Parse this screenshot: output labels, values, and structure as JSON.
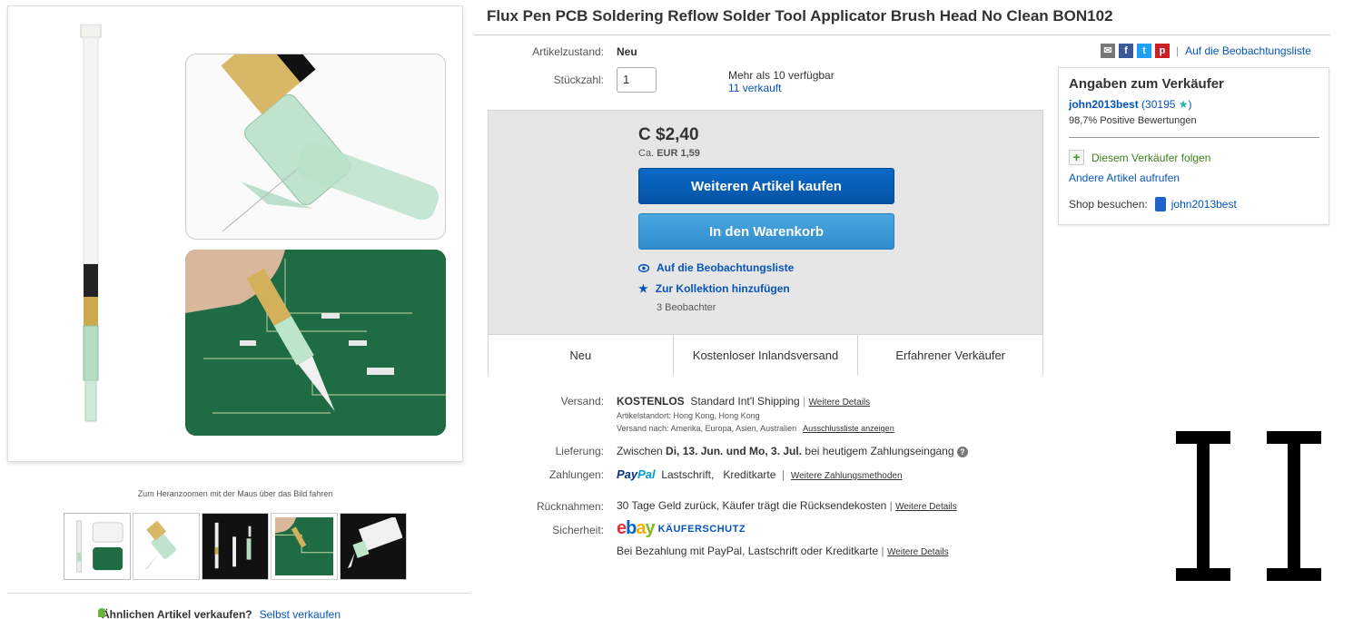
{
  "listing": {
    "title": "Flux Pen PCB Soldering Reflow Solder Tool Applicator Brush Head No Clean BON102"
  },
  "gallery": {
    "zoom_hint": "Zum Heranzoomen mit der Maus über das Bild fahren",
    "thumbnail_count": 5
  },
  "condition": {
    "label": "Artikelzustand:",
    "value": "Neu"
  },
  "quantity": {
    "label": "Stückzahl:",
    "value": "1",
    "available": "Mehr als 10 verfügbar",
    "sold": "11 verkauft"
  },
  "buy_box": {
    "price": "C $2,40",
    "approx_prefix": "Ca.",
    "approx_value": "EUR 1,59",
    "buy_button": "Weiteren Artikel kaufen",
    "cart_button": "In den Warenkorb",
    "watch_link": "Auf die Beobachtungsliste",
    "collection_link": "Zur Kollektion hinzufügen",
    "watchers": "3 Beobachter",
    "tiles": [
      "Neu",
      "Kostenloser Inlandsversand",
      "Erfahrener Verkäufer"
    ]
  },
  "shipping": {
    "label": "Versand:",
    "free": "KOSTENLOS",
    "method": "Standard Int'l Shipping",
    "details": "Weitere Details",
    "location": "Artikelstandort:  Hong Kong, Hong Kong",
    "ships_to": "Versand nach:  Amerika, Europa, Asien, Australien",
    "exclusions": "Ausschlussliste anzeigen"
  },
  "delivery": {
    "label": "Lieferung:",
    "prefix": "Zwischen",
    "range": "Di, 13. Jun. und Mo, 3. Jul.",
    "suffix": "bei heutigem Zahlungseingang"
  },
  "payments": {
    "label": "Zahlungen:",
    "paypal_a": "Pay",
    "paypal_b": "Pal",
    "methods": "Lastschrift,   Kreditkarte",
    "more": "Weitere Zahlungsmethoden"
  },
  "returns": {
    "label": "Rücknahmen:",
    "text": "30 Tage Geld zurück, Käufer trägt die Rücksendekosten",
    "details": "Weitere Details"
  },
  "security": {
    "label": "Sicherheit:",
    "brand_e": "e",
    "brand_b": "b",
    "brand_a": "a",
    "brand_y": "y",
    "badge": "KÄUFERSCHUTZ",
    "text": "Bei Bezahlung mit PayPal, Lastschrift oder Kreditkarte",
    "details": "Weitere Details"
  },
  "share": {
    "watchlist_link": "Auf die Beobachtungsliste",
    "icons": [
      "email-icon",
      "facebook-icon",
      "twitter-icon",
      "pinterest-icon"
    ]
  },
  "seller": {
    "heading": "Angaben zum Verkäufer",
    "name": "john2013best",
    "score_open": "(30195",
    "score_close": ")",
    "positive": "98,7% Positive Bewertungen",
    "follow": "Diesem Verkäufer folgen",
    "other_items": "Andere Artikel aufrufen",
    "store_label": "Shop besuchen:",
    "store_name": "john2013best"
  },
  "sell_similar": {
    "question": "Ähnlichen Artikel verkaufen?",
    "link": "Selbst verkaufen"
  },
  "colors": {
    "link": "#0654ba",
    "buy_button": "#0553a6",
    "cart_button": "#2f8ccc",
    "follow_green": "#3f7f1f"
  }
}
